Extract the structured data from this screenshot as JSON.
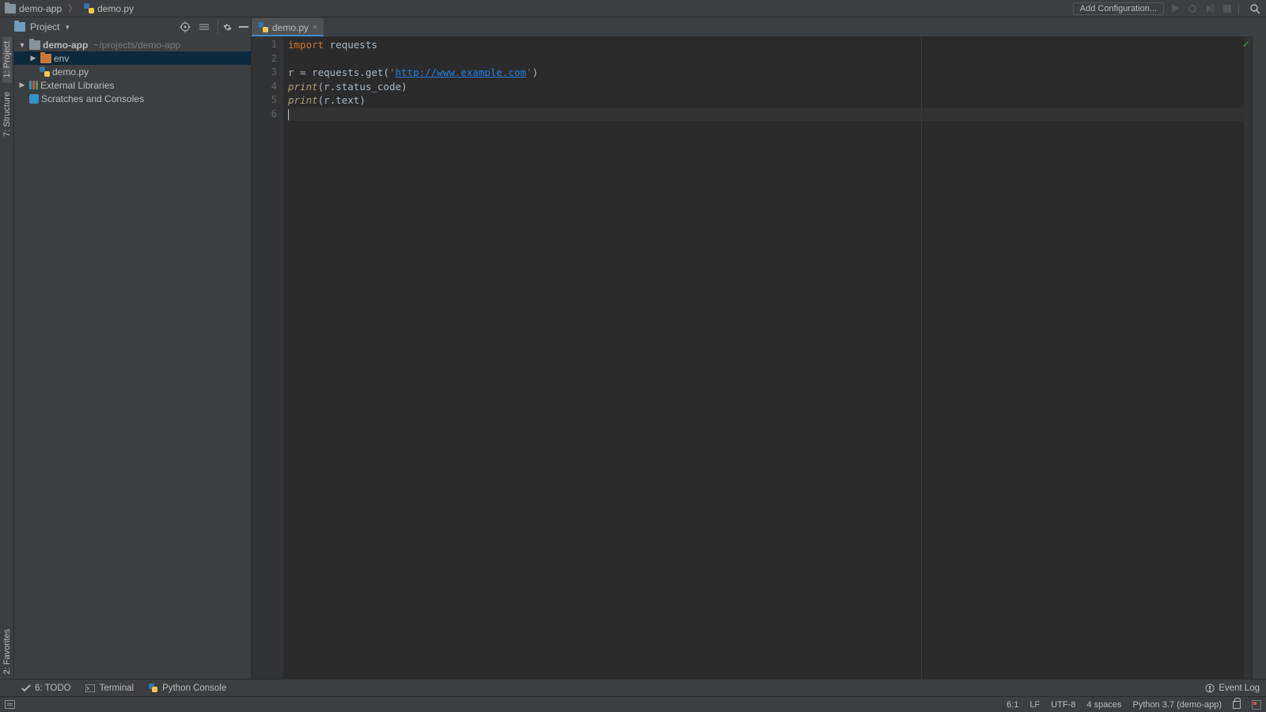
{
  "breadcrumb": {
    "project": "demo-app",
    "file": "demo.py"
  },
  "toolbar": {
    "add_config": "Add Configuration..."
  },
  "left_tools": {
    "project": "1: Project",
    "structure": "7: Structure",
    "favorites": "2: Favorites"
  },
  "project_header": {
    "title": "Project"
  },
  "tree": {
    "root": {
      "name": "demo-app",
      "path": "~/projects/demo-app"
    },
    "env": "env",
    "demo": "demo.py",
    "external": "External Libraries",
    "scratches": "Scratches and Consoles"
  },
  "tab": {
    "name": "demo.py"
  },
  "code": {
    "l1_kw": "import",
    "l1_rest": " requests",
    "l3_a": "r = requests.get(",
    "l3_q1": "'",
    "l3_url": "http://www.example.com",
    "l3_q2": "'",
    "l3_b": ")",
    "l4_fn": "print",
    "l4_rest": "(r.status_code)",
    "l5_fn": "print",
    "l5_rest": "(r.text)"
  },
  "line_numbers": [
    "1",
    "2",
    "3",
    "4",
    "5",
    "6"
  ],
  "bottom": {
    "todo": "6: TODO",
    "terminal": "Terminal",
    "pyconsole": "Python Console",
    "eventlog": "Event Log"
  },
  "status": {
    "pos": "6:1",
    "eol": "LF",
    "enc": "UTF-8",
    "indent": "4 spaces",
    "sdk": "Python 3.7 (demo-app)"
  }
}
